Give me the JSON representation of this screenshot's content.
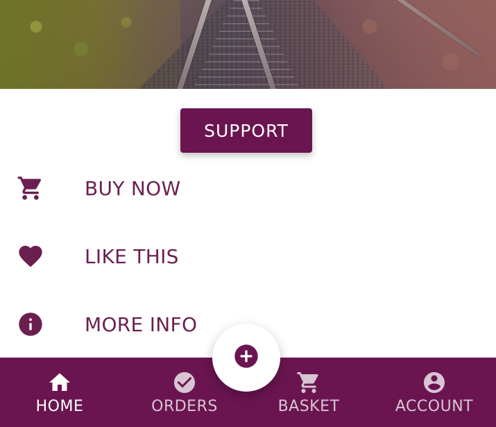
{
  "colors": {
    "primary": "#6a1550",
    "menu_text": "#6b1f4f",
    "nav_inactive": "rgba(255,255,255,0.75)",
    "nav_active": "#ffffff",
    "fab_bg": "#ffffff"
  },
  "hero": {
    "icon": "railway-tracks-image"
  },
  "support": {
    "label": "SUPPORT"
  },
  "menu": {
    "items": [
      {
        "label": "BUY NOW",
        "icon": "shopping-cart-icon"
      },
      {
        "label": "LIKE THIS",
        "icon": "heart-icon"
      },
      {
        "label": "MORE INFO",
        "icon": "info-icon"
      }
    ]
  },
  "fab": {
    "icon": "add-circle-icon"
  },
  "bottom_nav": {
    "items": [
      {
        "label": "HOME",
        "icon": "home-icon",
        "active": true
      },
      {
        "label": "ORDERS",
        "icon": "check-circle-icon",
        "active": false
      },
      {
        "label": "BASKET",
        "icon": "shopping-cart-icon",
        "active": false
      },
      {
        "label": "ACCOUNT",
        "icon": "account-circle-icon",
        "active": false
      }
    ]
  }
}
